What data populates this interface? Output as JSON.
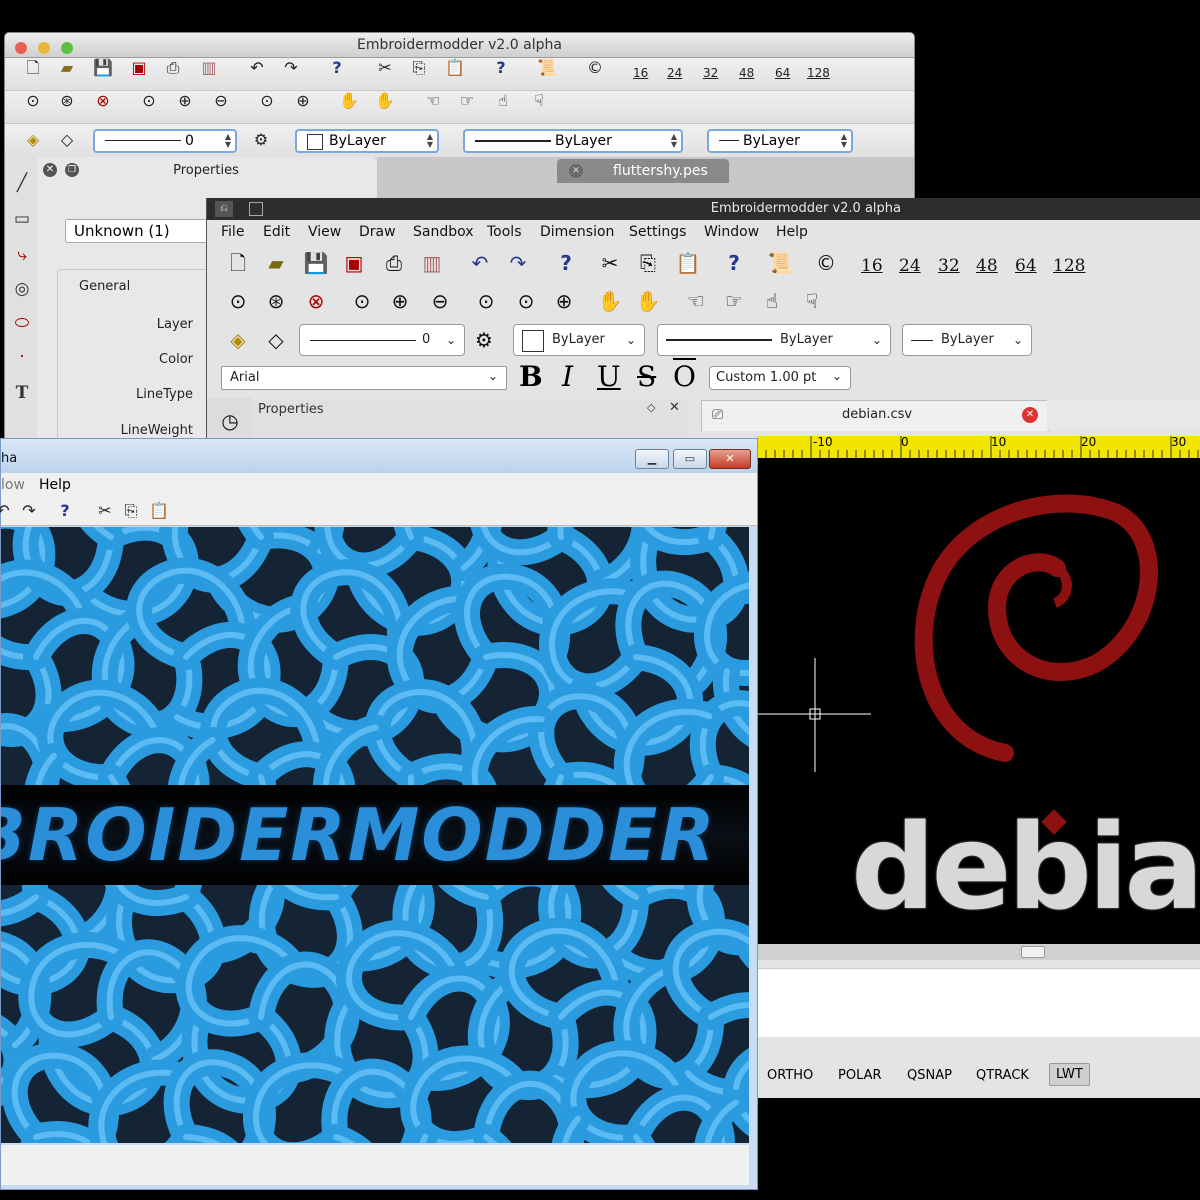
{
  "mac_window": {
    "title": "Embroidermodder v2.0 alpha",
    "line_combo_value": "0",
    "color_combo_value": "ByLayer",
    "linetype_combo_value": "ByLayer",
    "lineweight_combo_value": "ByLayer",
    "sizes": [
      "16",
      "24",
      "32",
      "48",
      "64",
      "128"
    ],
    "tab_label": "fluttershy.pes",
    "properties": {
      "title": "Properties",
      "selector_value": "Unknown (1)",
      "group_title": "General",
      "fields": [
        "Layer",
        "Color",
        "LineType",
        "LineWeight"
      ]
    }
  },
  "linux_window": {
    "title": "Embroidermodder v2.0 alpha",
    "menu": [
      "File",
      "Edit",
      "View",
      "Draw",
      "Sandbox",
      "Tools",
      "Dimension",
      "Settings",
      "Window",
      "Help"
    ],
    "sizes": [
      "16",
      "24",
      "32",
      "48",
      "64",
      "128"
    ],
    "line_combo_value": "0",
    "color_combo_value": "ByLayer",
    "linetype_combo_value": "ByLayer",
    "lineweight_combo_value": "ByLayer",
    "font_value": "Arial",
    "text_style_buttons": [
      "B",
      "I",
      "U",
      "S",
      "O"
    ],
    "text_size_value": "Custom 1.00 pt",
    "properties_title": "Properties",
    "tab_label": "debian.csv",
    "ruler_labels": [
      "-10",
      "0",
      "10",
      "20",
      "30"
    ],
    "canvas_text": "debian",
    "status_buttons": [
      "ORTHO",
      "POLAR",
      "QSNAP",
      "QTRACK",
      "LWT"
    ],
    "colors": {
      "ruler": "#f2e600",
      "swirl": "#8e1111",
      "text_white": "#d8d8d8"
    }
  },
  "windows_window": {
    "title_fragment": "ha",
    "menu_fragment": "low",
    "menu_help": "Help",
    "banner_text": "BROIDERMODDER",
    "colors": {
      "banner_text": "#2a8fd8",
      "swirl": "#2b9be0"
    }
  }
}
